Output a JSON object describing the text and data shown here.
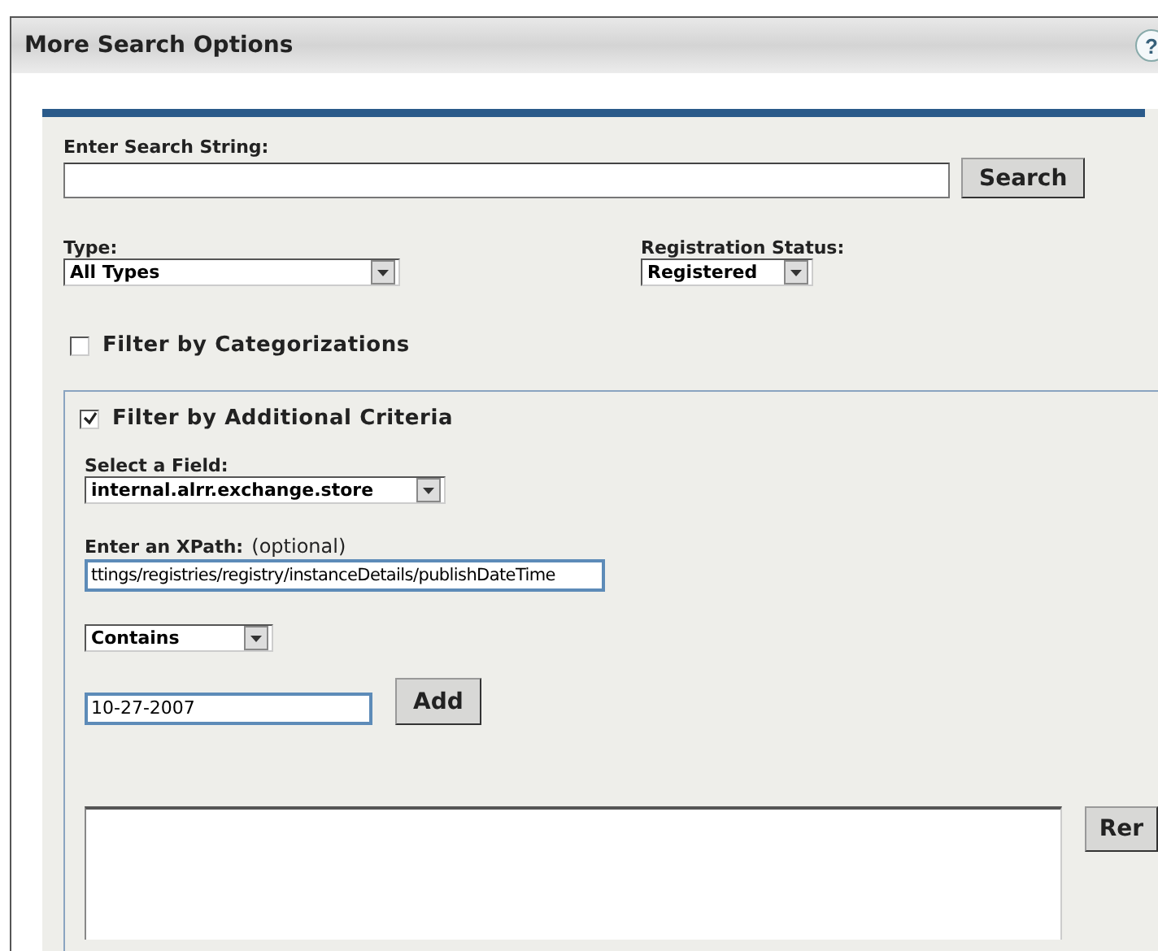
{
  "window": {
    "title": "More Search Options",
    "help": "?"
  },
  "search": {
    "label": "Enter Search String:",
    "button": "Search"
  },
  "type": {
    "label": "Type:",
    "value": "All Types"
  },
  "registration_status": {
    "label": "Registration Status:",
    "value": "Registered"
  },
  "filter_categorizations": {
    "label": "Filter by Categorizations",
    "checked": false
  },
  "filter_additional": {
    "label": "Filter by Additional Criteria",
    "checked": true,
    "field": {
      "label": "Select a Field:",
      "value": "internal.alrr.exchange.store"
    },
    "xpath": {
      "label": "Enter an XPath:",
      "hint": "(optional)",
      "value": "ttings/registries/registry/instanceDetails/publishDateTime"
    },
    "operator": {
      "value": "Contains"
    },
    "criterion": {
      "value": "10-27-2007",
      "button": "Add"
    },
    "remove_button": "Rer"
  }
}
